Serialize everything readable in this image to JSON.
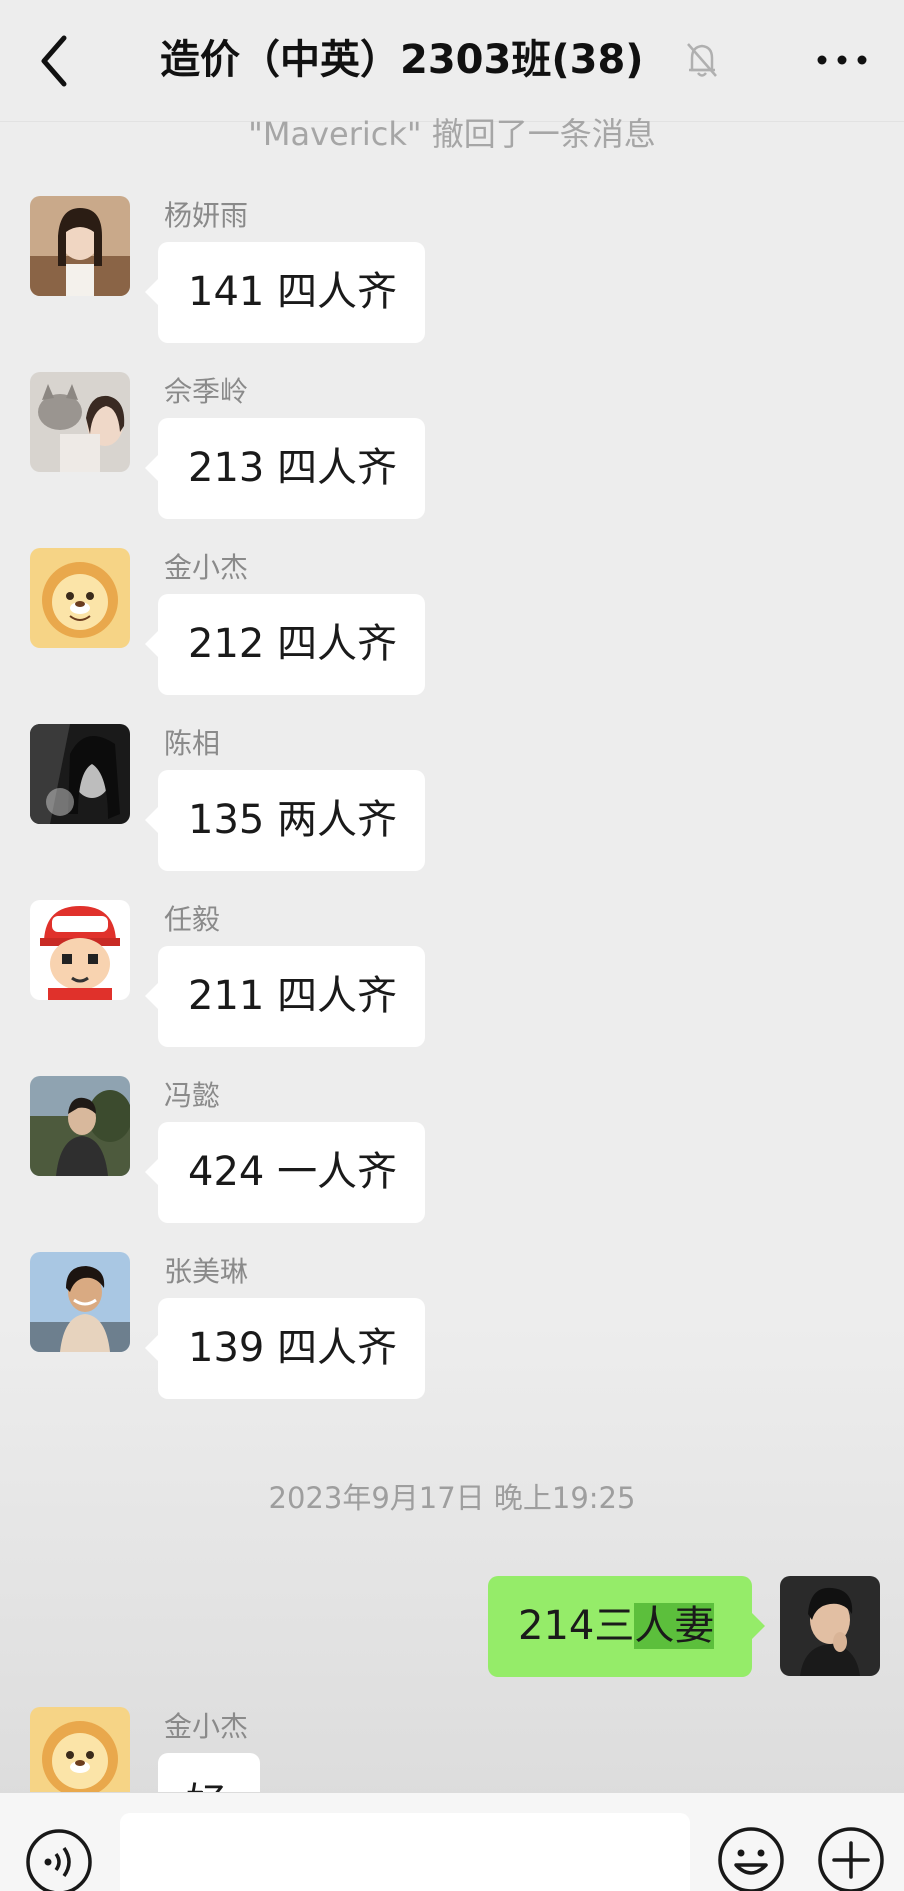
{
  "header": {
    "title": "造价（中英）2303班(38)",
    "back_icon": "chevron-left-icon",
    "mute_icon": "bell-off-icon",
    "more_icon": "more-dots-icon"
  },
  "system": {
    "recall_notice": "\"Maverick\" 撤回了一条消息",
    "timestamp": "2023年9月17日 晚上19:25"
  },
  "messages": [
    {
      "sender": "杨妍雨",
      "text": "141 四人齐"
    },
    {
      "sender": "佘季岭",
      "text": "213 四人齐"
    },
    {
      "sender": "金小杰",
      "text": "212 四人齐"
    },
    {
      "sender": "陈相",
      "text": "135 两人齐"
    },
    {
      "sender": "任毅",
      "text": "211 四人齐"
    },
    {
      "sender": "冯懿",
      "text": "424 一人齐"
    },
    {
      "sender": "张美琳",
      "text": "139 四人齐"
    }
  ],
  "outgoing": {
    "text_before": "214三",
    "text_highlight": "人妻",
    "bubble_color": "#95ec69",
    "highlight_color": "#5cbf3c"
  },
  "partial": {
    "sender": "金小杰",
    "text": "好"
  },
  "bottom": {
    "voice_icon": "voice-icon",
    "emoji_icon": "emoji-icon",
    "plus_icon": "plus-icon"
  }
}
